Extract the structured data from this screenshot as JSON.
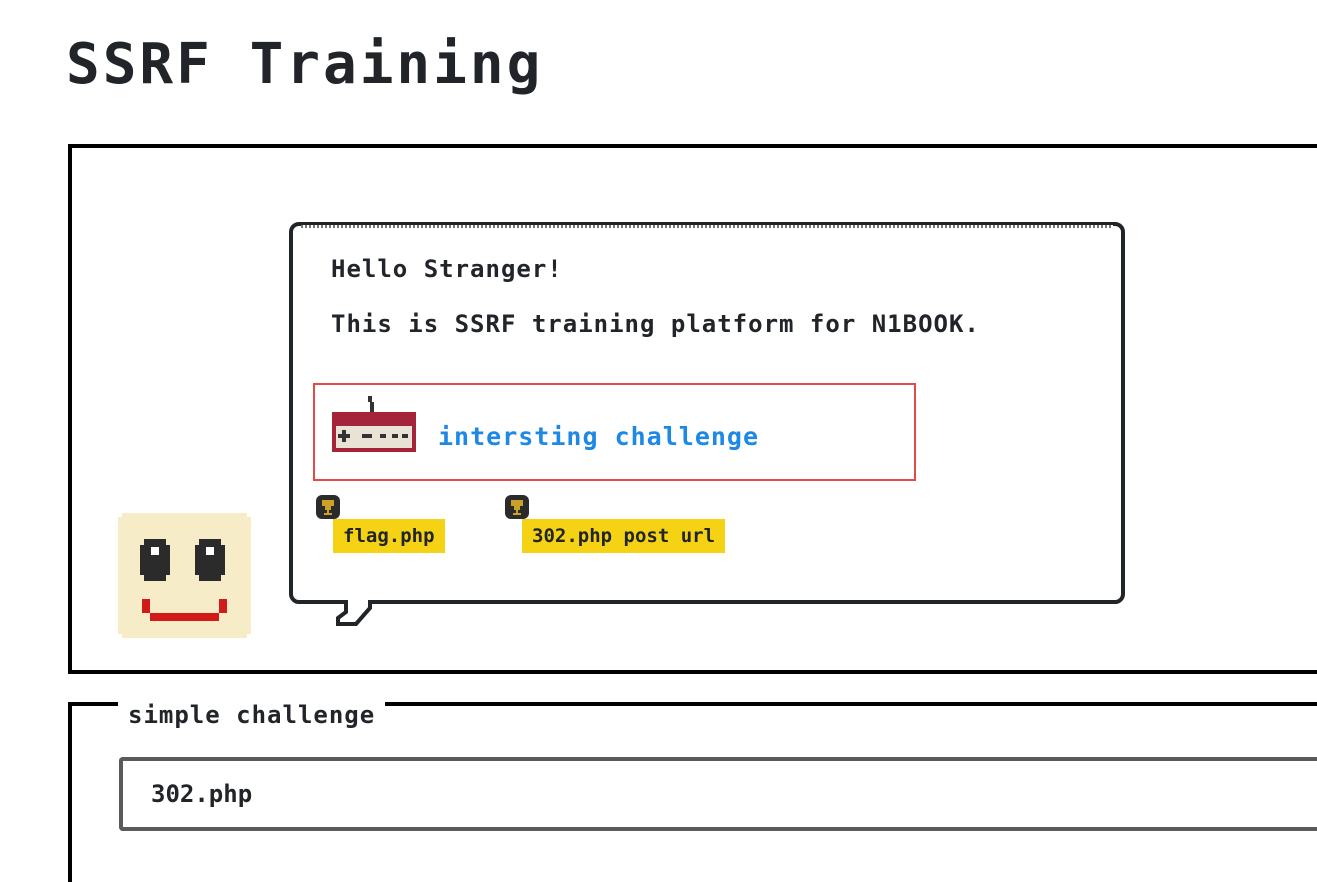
{
  "page": {
    "title": "SSRF Training"
  },
  "hero": {
    "greeting": "Hello Stranger!",
    "intro": "This is SSRF training platform for N1BOOK.",
    "challenge_link": "intersting challenge",
    "tags": [
      {
        "label": "flag.php"
      },
      {
        "label": "302.php post url"
      }
    ]
  },
  "simple": {
    "legend": "simple challenge",
    "input_value": "302.php"
  },
  "colors": {
    "tag_yellow": "#f5d214",
    "link_blue": "#1e88e5",
    "highlight_red": "#e34a4a",
    "controller_red": "#a3243b",
    "smiley_bg": "#f7ecc8",
    "smiley_mouth": "#d11a1a"
  },
  "icons": {
    "controller": "controller-icon",
    "trophy": "trophy-icon",
    "smiley": "smiley-icon"
  }
}
